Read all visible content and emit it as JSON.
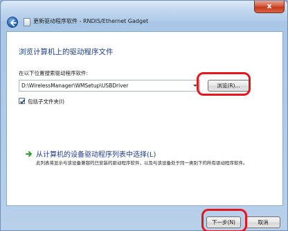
{
  "window": {
    "title": "更新驱动程序软件 - RNDIS/Ethernet Gadget",
    "close_label": "x"
  },
  "main": {
    "heading": "浏览计算机上的驱动程序文件",
    "search_label": "在以下位置搜索驱动程序软件:",
    "path_value": "D:\\WirelessManager\\WMSetup\\USBDriver",
    "browse_label": "浏览(R)...",
    "include_subfolders_label": "包括子文件夹(I)",
    "include_subfolders_checked": true,
    "pick_title": "从计算机的设备驱动程序列表中选择(L)",
    "pick_description": "此列表将显示与该设备兼容的已安装的驱动程序软件，以及与该设备处于同一类别下的所有驱动程序软件。"
  },
  "footer": {
    "next_label": "下一步(N)",
    "cancel_label": "取消"
  },
  "colors": {
    "heading": "#1e3e8a",
    "highlight": "#e8141b",
    "pick_arrow": "#2ca02c"
  },
  "icons": {
    "back": "back-arrow-icon",
    "wizard": "wizard-icon",
    "pick": "green-arrow-icon",
    "checkbox": "checkmark-icon"
  }
}
